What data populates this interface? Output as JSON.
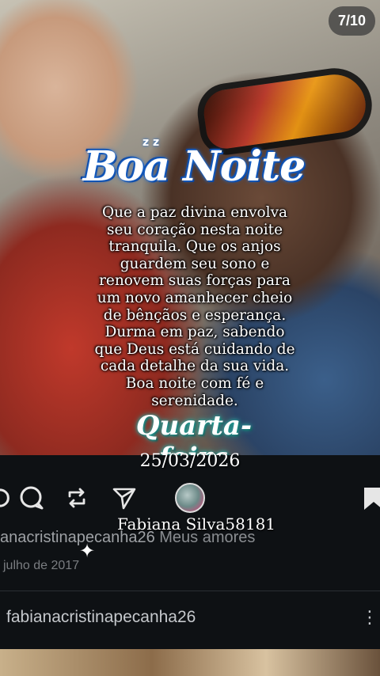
{
  "page_indicator": "7/10",
  "greeting": {
    "title": "Boa Noite",
    "zz": "z z",
    "message_lines": [
      "Que a paz divina envolva",
      "seu coração nesta noite",
      "tranquila. Que os anjos",
      "guardem seu sono e",
      "renovem suas forças para",
      "um novo amanhecer cheio",
      "de bênçãos e esperança.",
      "Durma em paz, sabendo",
      "que Deus está cuidando de",
      "cada detalhe da sua vida.",
      "Boa noite com fé e",
      "serenidade."
    ],
    "weekday": "Quarta-feira",
    "date": "25/03/2026"
  },
  "post": {
    "creator_name": "Fabiana Silva58181",
    "caption_user": "anacristinapecanha26",
    "caption_text": "Meus  amores",
    "post_date": "julho de 2017",
    "comment_user": "fabianacristinapecanha26"
  },
  "icons": {
    "comment": "comment-icon",
    "repost": "repost-icon",
    "share": "send-icon",
    "bookmark": "bookmark-icon",
    "more": "more-icon"
  },
  "colors": {
    "title_glow": "#1e6fd9",
    "weekday_glow": "#2aa7a0",
    "feed_bg": "#0e1114"
  }
}
